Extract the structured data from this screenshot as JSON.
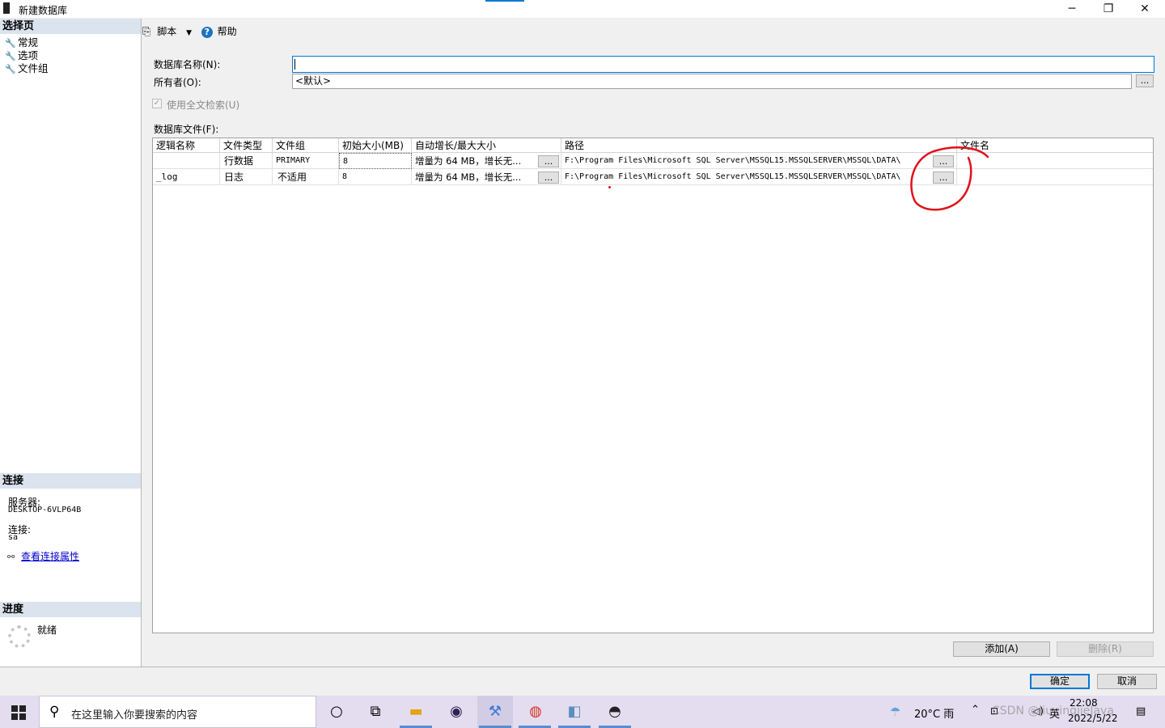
{
  "window": {
    "title": "新建数据库",
    "minimize": "─",
    "restore": "❐",
    "close": "✕"
  },
  "left": {
    "select_page_header": "选择页",
    "pages": [
      "常规",
      "选项",
      "文件组"
    ],
    "connection_header": "连接",
    "server_label": "服务器:",
    "server_value": "DESKTOP-6VLP64B",
    "connection_label": "连接:",
    "connection_value": "sa",
    "view_props_link": "查看连接属性",
    "progress_header": "进度",
    "progress_status": "就绪"
  },
  "toolbar": {
    "script_label": "脚本",
    "help_label": "帮助"
  },
  "form": {
    "db_name_label": "数据库名称(N):",
    "db_name_value": "",
    "owner_label": "所有者(O):",
    "owner_value": "<默认>",
    "owner_browse": "...",
    "fulltext_label": "使用全文检索(U)",
    "fulltext_checked": true,
    "files_label": "数据库文件(F):"
  },
  "grid": {
    "columns": [
      "逻辑名称",
      "文件类型",
      "文件组",
      "初始大小(MB)",
      "自动增长/最大大小",
      "路径",
      "文件名"
    ],
    "rows": [
      {
        "logical": "",
        "type": "行数据",
        "group": "PRIMARY",
        "size": "8",
        "growth": "增量为 64 MB，增长无...",
        "growth_btn": "...",
        "path": "F:\\Program Files\\Microsoft SQL Server\\MSSQL15.MSSQLSERVER\\MSSQL\\DATA\\",
        "path_btn": "...",
        "filename": ""
      },
      {
        "logical": "_log",
        "type": "日志",
        "group": "不适用",
        "size": "8",
        "growth": "增量为 64 MB，增长无...",
        "growth_btn": "...",
        "path": "F:\\Program Files\\Microsoft SQL Server\\MSSQL15.MSSQLSERVER\\MSSQL\\DATA\\",
        "path_btn": "...",
        "filename": ""
      }
    ]
  },
  "buttons": {
    "add": "添加(A)",
    "remove": "删除(R)",
    "ok": "确定",
    "cancel": "取消"
  },
  "taskbar": {
    "search_placeholder": "在这里输入你要搜索的内容",
    "weather": "20°C 雨",
    "time": "22:08",
    "date": "2022/5/22",
    "lang": "英",
    "watermark": "CSDN @liuyingjieJava"
  },
  "colors": {
    "accent": "#0078d7",
    "section_header": "#dbe3ef",
    "annotation": "#e0101a"
  }
}
